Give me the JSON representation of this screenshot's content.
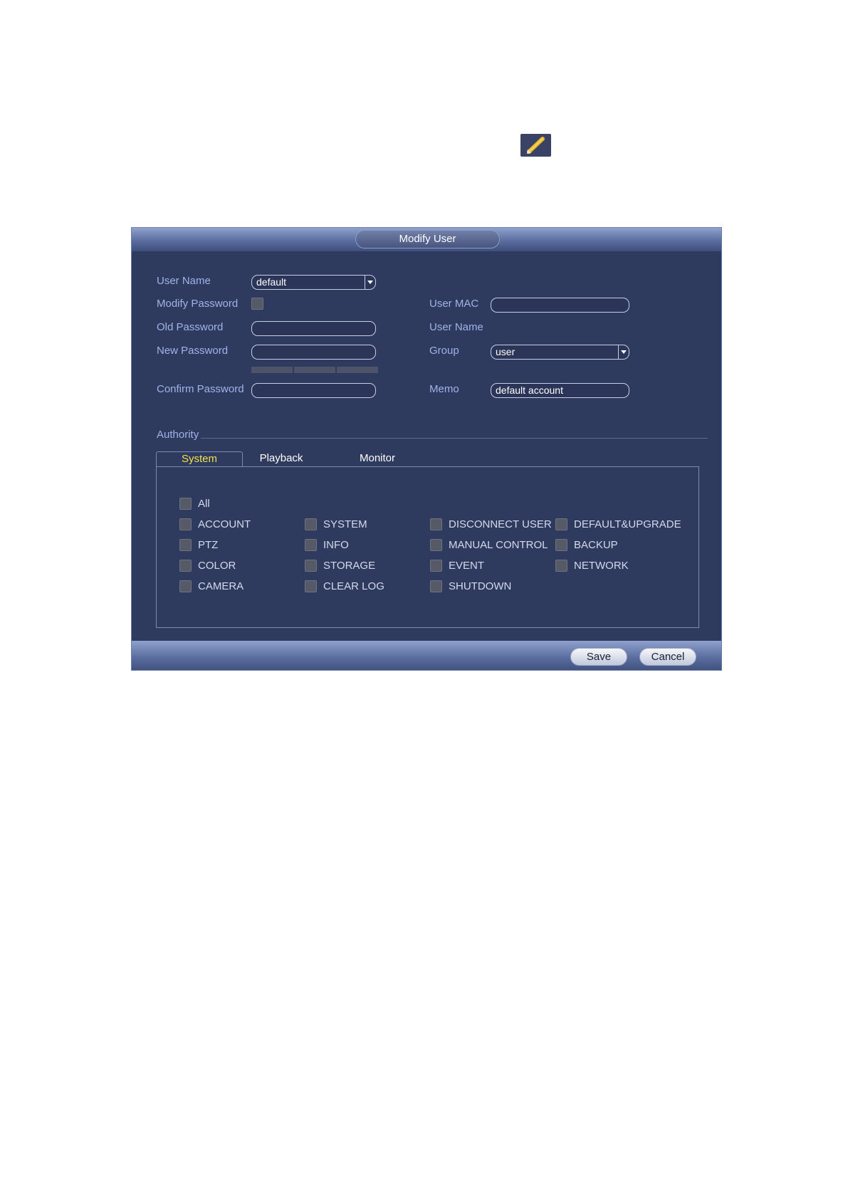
{
  "icons": {
    "edit": "pencil-icon"
  },
  "dialog": {
    "title": "Modify User",
    "form": {
      "user_name_label": "User Name",
      "user_name_value": "default",
      "modify_password_label": "Modify Password",
      "modify_password_checked": false,
      "old_password_label": "Old Password",
      "old_password_value": "",
      "new_password_label": "New Password",
      "new_password_value": "",
      "confirm_password_label": "Confirm Password",
      "confirm_password_value": "",
      "user_mac_label": "User MAC",
      "user_mac_value": "",
      "user_name2_label": "User Name",
      "group_label": "Group",
      "group_value": "user",
      "memo_label": "Memo",
      "memo_value": "default account"
    },
    "authority": {
      "label": "Authority",
      "tabs": [
        "System",
        "Playback",
        "Monitor"
      ],
      "active_tab": "System",
      "all_label": "All",
      "permissions": [
        "ACCOUNT",
        "SYSTEM",
        "DISCONNECT USER",
        "DEFAULT&UPGRADE",
        "PTZ",
        "INFO",
        "MANUAL CONTROL",
        "BACKUP",
        "COLOR",
        "STORAGE",
        "EVENT",
        "NETWORK",
        "CAMERA",
        "CLEAR LOG",
        "SHUTDOWN"
      ]
    },
    "buttons": {
      "save": "Save",
      "cancel": "Cancel"
    }
  },
  "colors": {
    "dialog_bg": "#2f3a5f",
    "label": "#9fb3e8",
    "active_tab": "#f0e14a"
  }
}
